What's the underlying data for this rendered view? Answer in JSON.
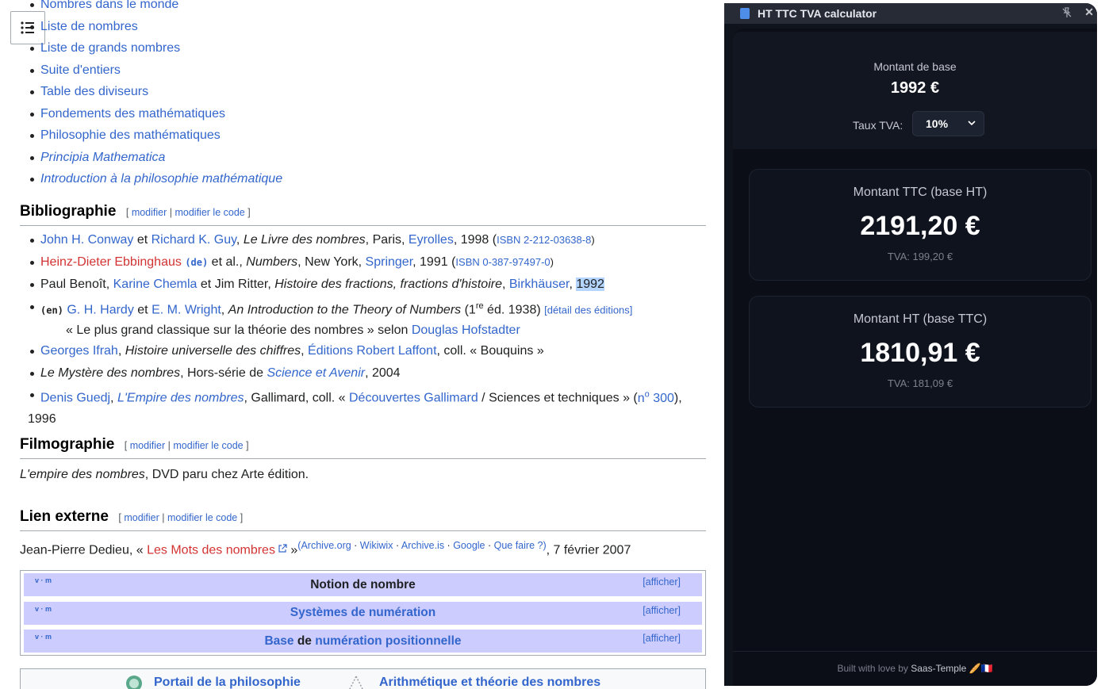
{
  "wiki": {
    "see_also": [
      {
        "text": "Nombres dans le monde",
        "italic": false
      },
      {
        "text": "Liste de nombres",
        "italic": false
      },
      {
        "text": "Liste de grands nombres",
        "italic": false
      },
      {
        "text": "Suite d'entiers",
        "italic": false
      },
      {
        "text": "Table des diviseurs",
        "italic": false
      },
      {
        "text": "Fondements des mathématiques",
        "italic": false
      },
      {
        "text": "Philosophie des mathématiques",
        "italic": false
      },
      {
        "text": "Principia Mathematica",
        "italic": true
      },
      {
        "text": "Introduction à la philosophie mathématique",
        "italic": true
      }
    ],
    "bibliographie": {
      "title": "Bibliographie",
      "edit": "modifier",
      "edit_code": "modifier le code",
      "b1": {
        "a1": "John H. Conway",
        "et": " et ",
        "a2": "Richard K. Guy",
        "rest1": ", ",
        "title": "Le Livre des nombres",
        "rest2": ", Paris, ",
        "pub": "Eyrolles",
        "rest3": ", 1998 (",
        "isbn": "ISBN 2-212-03638-8",
        "close": ")"
      },
      "b2": {
        "a1": "Heinz-Dieter Ebbinghaus",
        "lang": "(de)",
        "rest1": " et al., ",
        "title": "Numbers",
        "rest2": ", New York, ",
        "pub": "Springer",
        "rest3": ", 1991 (",
        "isbn": "ISBN 0-387-97497-0",
        "close": ")"
      },
      "b3": {
        "a1": "Paul Benoît, ",
        "a2": "Karine Chemla",
        "rest1": " et Jim Ritter, ",
        "title": "Histoire des fractions, fractions d'histoire",
        "rest2": ", ",
        "pub": "Birkhäuser",
        "rest3": ", ",
        "year": "1992"
      },
      "b4": {
        "lang": "(en)",
        "a1": "G. H. Hardy",
        "et": " et ",
        "a2": "E. M. Wright",
        "rest1": ", ",
        "title": "An Introduction to the Theory of Numbers",
        "rest2": " (1",
        "sup": "re",
        "rest3": " éd. 1938) ",
        "detail": "[détail des éditions]"
      },
      "b4_quote": {
        "text": "« Le plus grand classique sur la théorie des nombres » selon ",
        "who": "Douglas Hofstadter"
      },
      "b5": {
        "a1": "Georges Ifrah",
        "rest1": ", ",
        "title": "Histoire universelle des chiffres",
        "rest2": ", ",
        "pub": "Éditions Robert Laffont",
        "rest3": ", coll. « Bouquins »"
      },
      "b6": {
        "title": "Le Mystère des nombres",
        "rest1": ", Hors-série de ",
        "pub": "Science et Avenir",
        "rest2": ", 2004"
      },
      "b7": {
        "a1": "Denis Guedj",
        "rest1": ", ",
        "title": "L'Empire des nombres",
        "rest2": ", Gallimard, coll. « ",
        "coll": "Découvertes Gallimard",
        "rest3": " / Sciences et techniques » (",
        "num": "n",
        "num_sup": "o",
        "num2": " 300",
        "rest4": "),",
        "year": "1996"
      }
    },
    "filmographie": {
      "title": "Filmographie",
      "edit": "modifier",
      "edit_code": "modifier le code",
      "title_i": "L'empire des nombres",
      "rest": ", DVD paru chez Arte édition."
    },
    "lien": {
      "title": "Lien externe",
      "edit": "modifier",
      "edit_code": "modifier le code",
      "author": "Jean-Pierre Dedieu, « ",
      "link": "Les Mots des nombres",
      "after": " »",
      "archive": "(Archive.org",
      "wikiwix": "Wikiwix",
      "archiveis": "Archive.is",
      "google": "Google",
      "quefaire": "Que faire ?)",
      "date": ", 7 février 2007"
    },
    "navbox": [
      {
        "vm": "v · m",
        "title": "Notion de nombre",
        "show": "[afficher]"
      },
      {
        "vm": "v · m",
        "title": "Systèmes de numération",
        "show": "[afficher]"
      },
      {
        "vm": "v · m",
        "title_a": "Base",
        "title_b": " de ",
        "title_c": "numération positionnelle",
        "show": "[afficher]"
      }
    ],
    "portals": [
      "Portail de la philosophie",
      "Arithmétique et théorie des nombres"
    ]
  },
  "extension": {
    "title": "HT TTC TVA calculator",
    "base_label": "Montant de base",
    "base_value": "1992 €",
    "taux_label": "Taux TVA:",
    "taux_value": "10%",
    "ttc": {
      "label": "Montant TTC (base HT)",
      "value": "2191,20 €",
      "tva": "TVA: 199,20 €"
    },
    "ht": {
      "label": "Montant HT (base TTC)",
      "value": "1810,91 €",
      "tva": "TVA: 181,09 €"
    },
    "footer_prefix": "Built with love by ",
    "footer_brand": "Saas-Temple",
    "footer_emoji": "🥖🇫🇷"
  },
  "colors": {
    "link": "#3366cc",
    "redlink": "#d33333",
    "panel_bg": "#0b0e16",
    "navbox_bg": "#ccccff"
  }
}
